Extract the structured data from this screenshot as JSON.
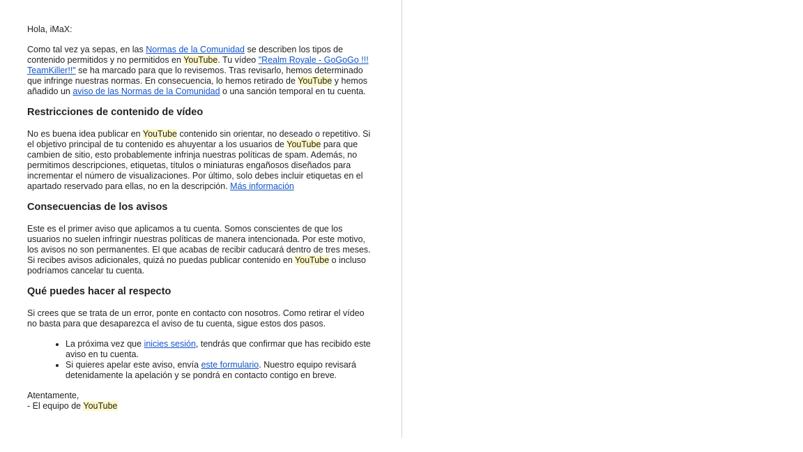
{
  "email": {
    "greeting": "Hola, iMaX:",
    "intro": {
      "t1": "Como tal vez ya sepas, en las ",
      "link_norms": "Normas de la Comunidad",
      "t2": " se describen los tipos de contenido permitidos y no permitidos en ",
      "brand": "YouTube",
      "t3": ". Tu vídeo ",
      "link_video": "\"Realm Royale - GoGoGo !!! TeamKiller!!\"",
      "t4": " se ha marcado para que lo revisemos. Tras revisarlo, hemos determinado que infringe nuestras normas. En consecuencia, lo hemos retirado de ",
      "t5": " y hemos añadido un ",
      "link_warning": "aviso de las Normas de la Comunidad",
      "t6": " o una sanción temporal en tu cuenta."
    },
    "section1": {
      "heading": "Restricciones de contenido de vídeo",
      "t1": "No es buena idea publicar en ",
      "t2": " contenido sin orientar, no deseado o repetitivo. Si el objetivo principal de tu contenido es ahuyentar a los usuarios de ",
      "t3": " para que cambien de sitio, esto probablemente infrinja nuestras políticas de spam. Además, no permitimos descripciones, etiquetas, títulos o miniaturas engañosos diseñados para incrementar el número de visualizaciones. Por último, solo debes incluir etiquetas en el apartado reservado para ellas, no en la descripción. ",
      "link_more": "Más información"
    },
    "section2": {
      "heading": "Consecuencias de los avisos",
      "t1": "Este es el primer aviso que aplicamos a tu cuenta. Somos conscientes de que los usuarios no suelen infringir nuestras políticas de manera intencionada. Por este motivo, los avisos no son permanentes. El que acabas de recibir caducará dentro de tres meses. Si recibes avisos adicionales, quizá no puedas publicar contenido en ",
      "t2": " o incluso podríamos cancelar tu cuenta."
    },
    "section3": {
      "heading": "Qué puedes hacer al respecto",
      "t1": "Si crees que se trata de un error, ponte en contacto con nosotros. Como retirar el vídeo no basta para que desaparezca el aviso de tu cuenta, sigue estos dos pasos.",
      "bullet1": {
        "t1": "La próxima vez que ",
        "link": "inicies sesión",
        "t2": ", tendrás que confirmar que has recibido este aviso en tu cuenta."
      },
      "bullet2": {
        "t1": "Si quieres apelar este aviso, envía ",
        "link": "este formulario",
        "t2": ". Nuestro equipo revisará detenidamente la apelación y se pondrá en contacto contigo en breve."
      }
    },
    "closing": "Atentamente,",
    "signature_prefix": "- El equipo de ",
    "colors": {
      "link": "#1155cc",
      "highlight": "#fff8c5",
      "text": "#222222"
    }
  }
}
